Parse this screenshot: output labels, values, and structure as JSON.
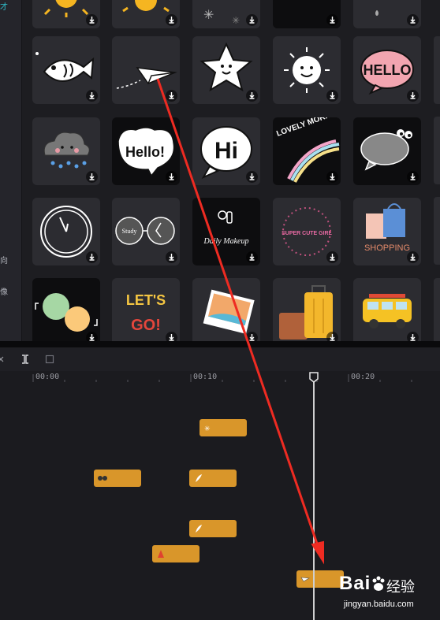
{
  "sidebar": {
    "items": [
      {
        "label": "才"
      },
      {
        "label": "向"
      },
      {
        "label": "像"
      }
    ]
  },
  "stickers": [
    {
      "name": "sun-sticker-1"
    },
    {
      "name": "sun-sticker-2"
    },
    {
      "name": "sparkle-sticker"
    },
    {
      "name": "blank-sticker"
    },
    {
      "name": "drop-sticker"
    },
    {
      "name": "fish-sticker"
    },
    {
      "name": "paper-plane-sticker"
    },
    {
      "name": "star-face-sticker"
    },
    {
      "name": "smiling-sun-sticker"
    },
    {
      "name": "hello-bubble-sticker",
      "text": "HELLO"
    },
    {
      "name": "rain-cloud-sticker"
    },
    {
      "name": "hello-heart-sticker",
      "text": "Hello!"
    },
    {
      "name": "hi-bubble-sticker",
      "text": "Hi"
    },
    {
      "name": "lovely-morning-sticker",
      "text": "LOVELY MORNING"
    },
    {
      "name": "eyes-bubble-sticker"
    },
    {
      "name": "clock-sticker"
    },
    {
      "name": "study-glasses-sticker",
      "text": "Study"
    },
    {
      "name": "daily-makeup-sticker",
      "text": "Daily Makeup"
    },
    {
      "name": "super-cute-girl-sticker",
      "text": "SUPER CUTE GIRL"
    },
    {
      "name": "shopping-sticker",
      "text": "SHOPPING"
    },
    {
      "name": "circles-sticker"
    },
    {
      "name": "lets-go-sticker",
      "text1": "LET'S",
      "text2": "GO!"
    },
    {
      "name": "photo-sticker"
    },
    {
      "name": "luggage-sticker"
    },
    {
      "name": "van-sticker"
    }
  ],
  "timeline": {
    "ruler": [
      "00:00",
      "00:10",
      "00:20"
    ]
  },
  "watermark": {
    "brand": "Bai",
    "brand_cn": "经验",
    "url": "jingyan.baidu.com"
  },
  "colors": {
    "clip": "#d9962a",
    "arrow": "#ee2b22",
    "playhead": "#cfcfcf"
  }
}
